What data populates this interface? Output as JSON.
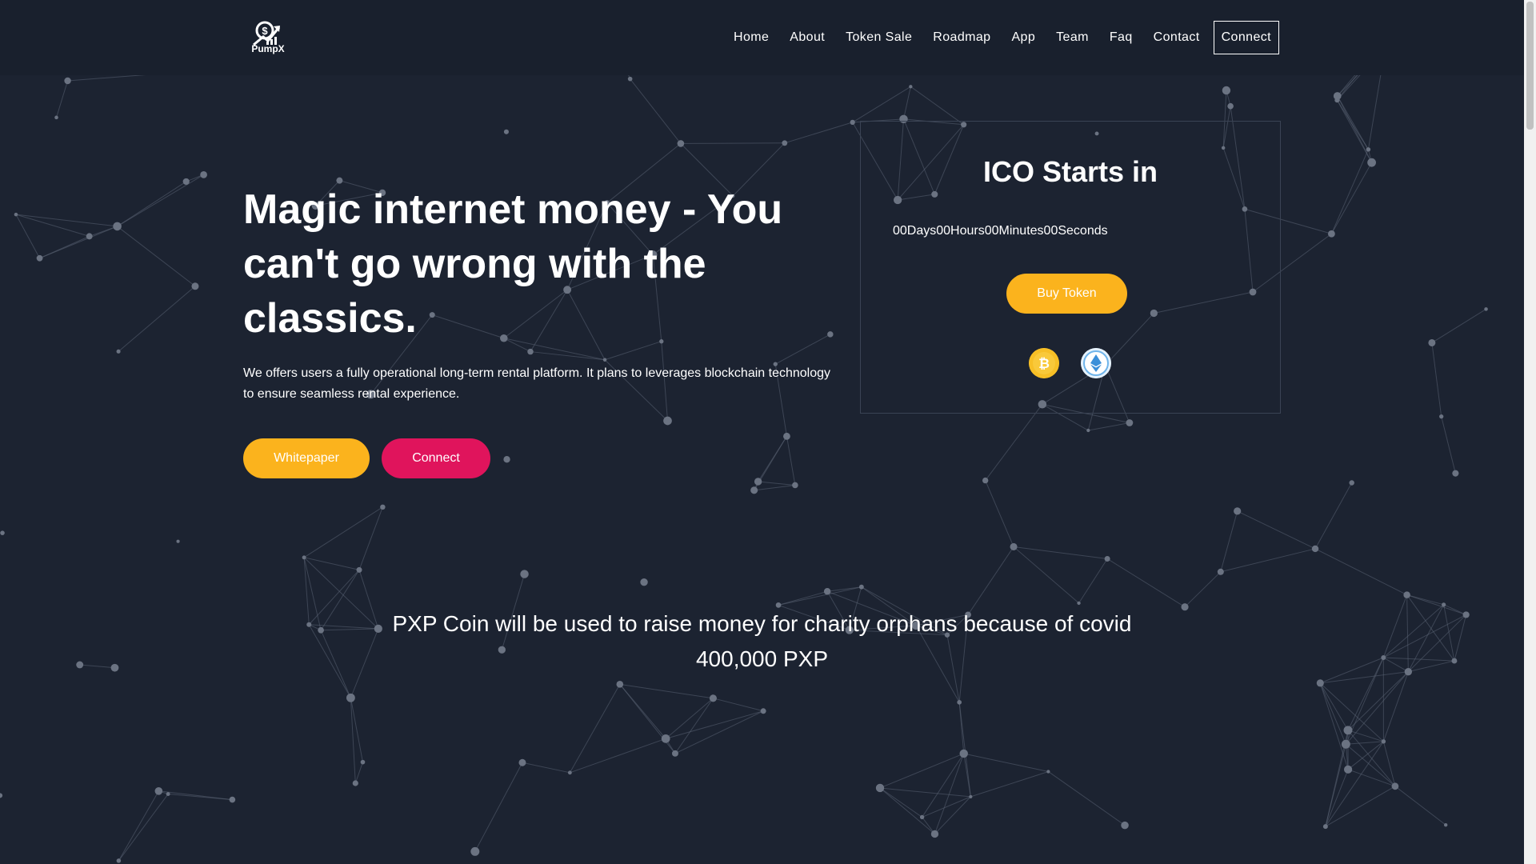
{
  "navbar": {
    "logo_text": "PumpX",
    "links": [
      "Home",
      "About",
      "Token Sale",
      "Roadmap",
      "App",
      "Team",
      "Faq",
      "Contact"
    ],
    "connect_label": "Connect"
  },
  "hero": {
    "title": "Magic internet money - You can't go wrong with the classics.",
    "description": "We offers users a fully operational long-term rental platform. It plans to leverages blockchain technology to ensure seamless rental experience.",
    "whitepaper_label": "Whitepaper",
    "connect_label": "Connect"
  },
  "ico": {
    "title": "ICO Starts in",
    "countdown": "00Days00Hours00Minutes00Seconds",
    "buy_label": "Buy Token",
    "coins": [
      "bitcoin-icon",
      "ethereum-icon"
    ]
  },
  "charity": {
    "line1": "PXP Coin will be used to raise money for charity orphans because of covid",
    "line2": "400,000 PXP"
  },
  "colors": {
    "background": "#1c2331",
    "navbar": "#19202d",
    "accent_yellow": "#fbb31d",
    "accent_pink": "#e0145c"
  }
}
